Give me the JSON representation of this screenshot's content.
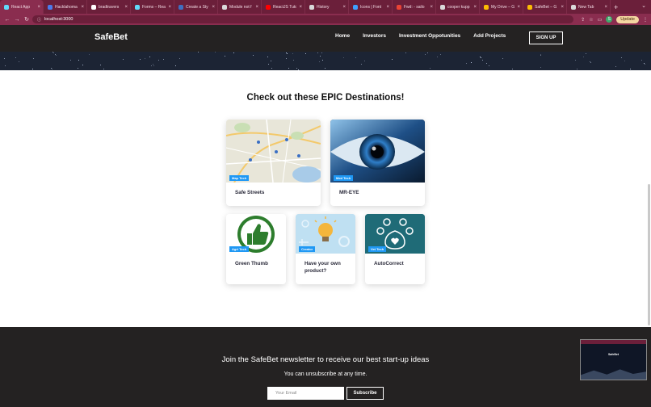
{
  "browser": {
    "tabs": [
      {
        "title": "React App",
        "color": "#61dafb",
        "active": true
      },
      {
        "title": "Hacklahoma",
        "color": "#4b7bec"
      },
      {
        "title": "bradtravers",
        "color": "#ffffff"
      },
      {
        "title": "Forms – Rea",
        "color": "#61dafb"
      },
      {
        "title": "Create a Sty",
        "color": "#3f6fc1"
      },
      {
        "title": "Module not f",
        "color": "#d9d9d9"
      },
      {
        "title": "ReactJS Tuto",
        "color": "#ff0000"
      },
      {
        "title": "History",
        "color": "#d9d9d9"
      },
      {
        "title": "Icons | Font",
        "color": "#3ea0ff"
      },
      {
        "title": "Fwd: - sailo",
        "color": "#ea4335"
      },
      {
        "title": "cooper kupp",
        "color": "#d9d9d9"
      },
      {
        "title": "My Drive – G",
        "color": "#fbbc04"
      },
      {
        "title": "SafeBet – G",
        "color": "#fbbc04"
      },
      {
        "title": "New Tab",
        "color": "#d9d9d9"
      }
    ],
    "url": "localhost:3000",
    "update_label": "Update",
    "avatar_letter": "S"
  },
  "site": {
    "brand": "SafeBet",
    "nav": [
      "Home",
      "Investors",
      "Investment Oppotunities",
      "Add Projects"
    ],
    "signup_label": "SIGN UP"
  },
  "section": {
    "title": "Check out these EPIC Destinations!"
  },
  "cards": [
    {
      "tag": "Map Tech",
      "caption": "Safe Streets",
      "image": "map-image"
    },
    {
      "tag": "Med Tech",
      "caption": "MR-EYE",
      "image": "eye-image"
    },
    {
      "tag": "Agri Tech",
      "caption": "Green Thumb",
      "image": "thumbs-up-image"
    },
    {
      "tag": "Creator",
      "caption": "Have your own product?",
      "image": "lightbulb-image"
    },
    {
      "tag": "Vet Tech",
      "caption": "AutoCorrect",
      "image": "paw-image"
    }
  ],
  "footer": {
    "heading": "Join the SafeBet newsletter to receive our best start-up ideas",
    "subheading": "You can unsubscribe at any time.",
    "email_placeholder": "Your Email",
    "subscribe_label": "Subscribe"
  },
  "pip": {
    "brand": "SafeBet"
  },
  "colors": {
    "tab_bar": "#6b1f3a",
    "nav_bg": "#242222",
    "tag_blue": "#1f98f4"
  }
}
